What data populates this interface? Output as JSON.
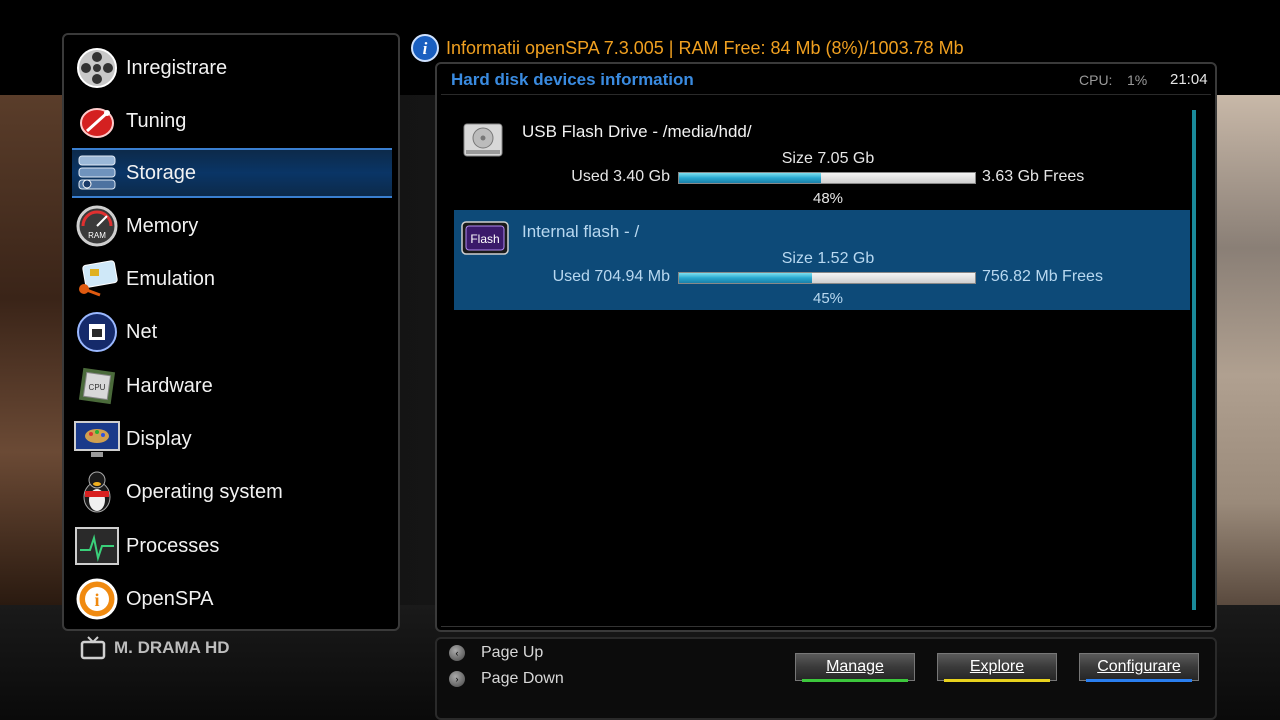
{
  "header": {
    "info_text": "Informatii openSPA 7.3.005 | RAM Free: 84 Mb (8%)/1003.78 Mb"
  },
  "menu": {
    "items": [
      {
        "label": "Inregistrare",
        "icon": "film-reel-icon"
      },
      {
        "label": "Tuning",
        "icon": "satellite-dish-icon"
      },
      {
        "label": "Storage",
        "icon": "hard-disk-stack-icon",
        "selected": true
      },
      {
        "label": "Memory",
        "icon": "ram-gauge-icon"
      },
      {
        "label": "Emulation",
        "icon": "smart-card-key-icon"
      },
      {
        "label": "Net",
        "icon": "network-globe-icon"
      },
      {
        "label": "Hardware",
        "icon": "cpu-chip-icon"
      },
      {
        "label": "Display",
        "icon": "monitor-palette-icon"
      },
      {
        "label": "Operating system",
        "icon": "linux-penguin-icon"
      },
      {
        "label": "Processes",
        "icon": "activity-monitor-icon"
      },
      {
        "label": "OpenSPA",
        "icon": "info-badge-icon"
      }
    ]
  },
  "channel": {
    "name": "M. DRAMA HD",
    "icon": "tv-icon"
  },
  "main": {
    "title": "Hard disk devices information",
    "cpu_label": "CPU:",
    "cpu_value": "1%",
    "clock": "21:04",
    "devices": [
      {
        "name": "USB Flash Drive - /media/hdd/",
        "icon": "hard-disk-icon",
        "size": "Size 7.05 Gb",
        "used": "Used 3.40 Gb",
        "free": "3.63 Gb Frees",
        "percent": "48%",
        "fill": 48,
        "selected": false
      },
      {
        "name": "Internal flash - /",
        "icon": "flash-chip-icon",
        "icon_text": "Flash",
        "size": "Size 1.52 Gb",
        "used": "Used 704.94 Mb",
        "free": "756.82 Mb Frees",
        "percent": "45%",
        "fill": 45,
        "selected": true
      }
    ]
  },
  "footer": {
    "page_up": "Page Up",
    "page_down": "Page Down",
    "buttons": [
      {
        "label": "Manage",
        "color": "#3cc83c"
      },
      {
        "label": "Explore",
        "color": "#e8d21e"
      },
      {
        "label": "Configurare",
        "color": "#2a7ff0"
      }
    ]
  },
  "colors": {
    "accent_title": "#3a8be0",
    "info_orange": "#f0a020",
    "selection_blue": "#0d4a78"
  }
}
